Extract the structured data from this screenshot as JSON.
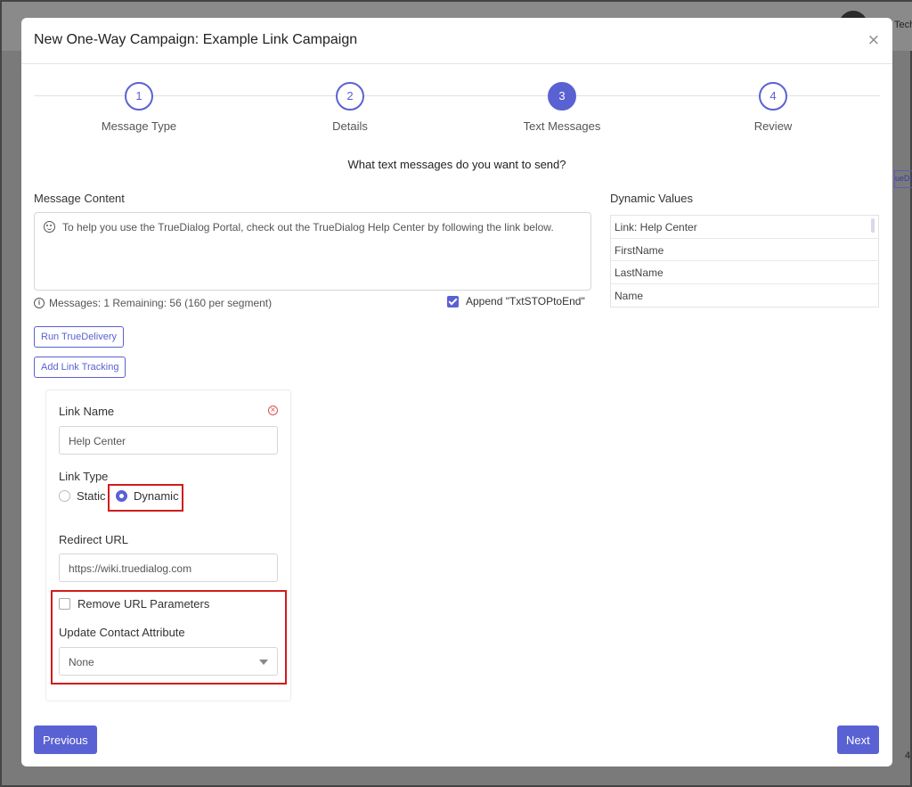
{
  "modal": {
    "title": "New One-Way Campaign: Example Link Campaign",
    "close": "×"
  },
  "steps": [
    {
      "number": "1",
      "label": "Message Type"
    },
    {
      "number": "2",
      "label": "Details"
    },
    {
      "number": "3",
      "label": "Text Messages"
    },
    {
      "number": "4",
      "label": "Review"
    }
  ],
  "question": "What text messages do you want to send?",
  "message": {
    "label": "Message Content",
    "content": "To help you use the TrueDialog Portal, check out the TrueDialog Help Center by following the link below.",
    "info": "Messages: 1 Remaining: 56 (160 per segment)",
    "append_label": "Append \"TxtSTOPtoEnd\""
  },
  "dynamic_values": {
    "label": "Dynamic Values",
    "items": [
      "Link: Help Center",
      "FirstName",
      "LastName",
      "Name"
    ]
  },
  "buttons": {
    "run_truedelivery": "Run TrueDelivery",
    "add_link_tracking": "Add Link Tracking",
    "previous": "Previous",
    "next": "Next"
  },
  "link_tracking": {
    "link_name_label": "Link Name",
    "link_name_value": "Help Center",
    "link_type_label": "Link Type",
    "link_type_options": [
      "Static",
      "Dynamic"
    ],
    "link_type_selected": "Dynamic",
    "redirect_url_label": "Redirect URL",
    "redirect_url_value": "https://wiki.truedialog.com",
    "remove_params_label": "Remove URL Parameters",
    "update_attr_label": "Update Contact Attribute",
    "update_attr_value": "None"
  },
  "background": {
    "header_fragment": "Tech",
    "button_fragment": "ueDe",
    "number_fragment": "4"
  },
  "colors": {
    "accent": "#5a61d3",
    "highlight": "#d11c1c"
  }
}
